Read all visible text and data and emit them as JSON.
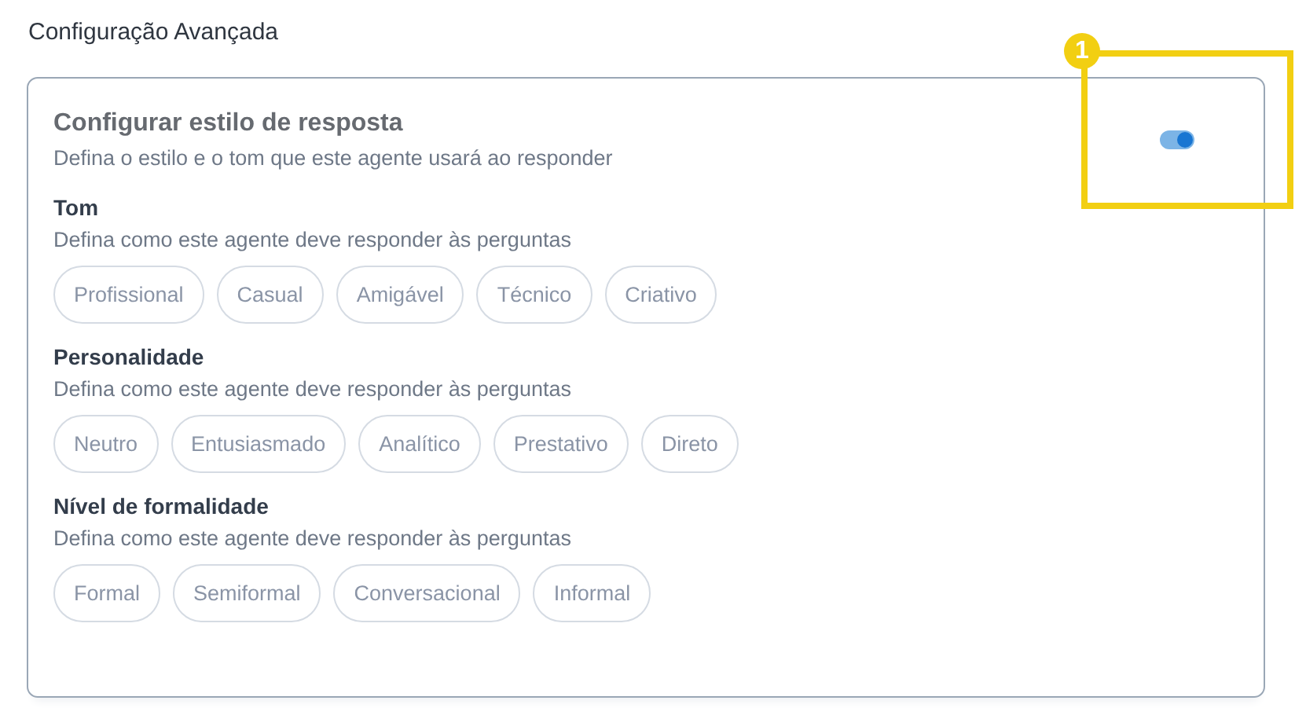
{
  "page_title": "Configuração Avançada",
  "card": {
    "title": "Configurar estilo de resposta",
    "description": "Defina o estilo e o tom que este agente usará ao responder",
    "toggle": {
      "on": true
    },
    "groups": [
      {
        "label": "Tom",
        "description": "Defina como este agente deve responder às perguntas",
        "options": [
          {
            "label": "Profissional",
            "selected": false
          },
          {
            "label": "Casual",
            "selected": false
          },
          {
            "label": "Amigável",
            "selected": false
          },
          {
            "label": "Técnico",
            "selected": false
          },
          {
            "label": "Criativo",
            "selected": false
          }
        ]
      },
      {
        "label": "Personalidade",
        "description": "Defina como este agente deve responder às perguntas",
        "options": [
          {
            "label": "Neutro",
            "selected": false
          },
          {
            "label": "Entusiasmado",
            "selected": false
          },
          {
            "label": "Analítico",
            "selected": false
          },
          {
            "label": "Prestativo",
            "selected": false
          },
          {
            "label": "Direto",
            "selected": false
          }
        ]
      },
      {
        "label": "Nível de formalidade",
        "description": "Defina como este agente deve responder às perguntas",
        "options": [
          {
            "label": "Formal",
            "selected": false
          },
          {
            "label": "Semiformal",
            "selected": false
          },
          {
            "label": "Conversacional",
            "selected": false
          },
          {
            "label": "Informal",
            "selected": false
          }
        ]
      }
    ]
  },
  "callout": {
    "number": "1"
  }
}
